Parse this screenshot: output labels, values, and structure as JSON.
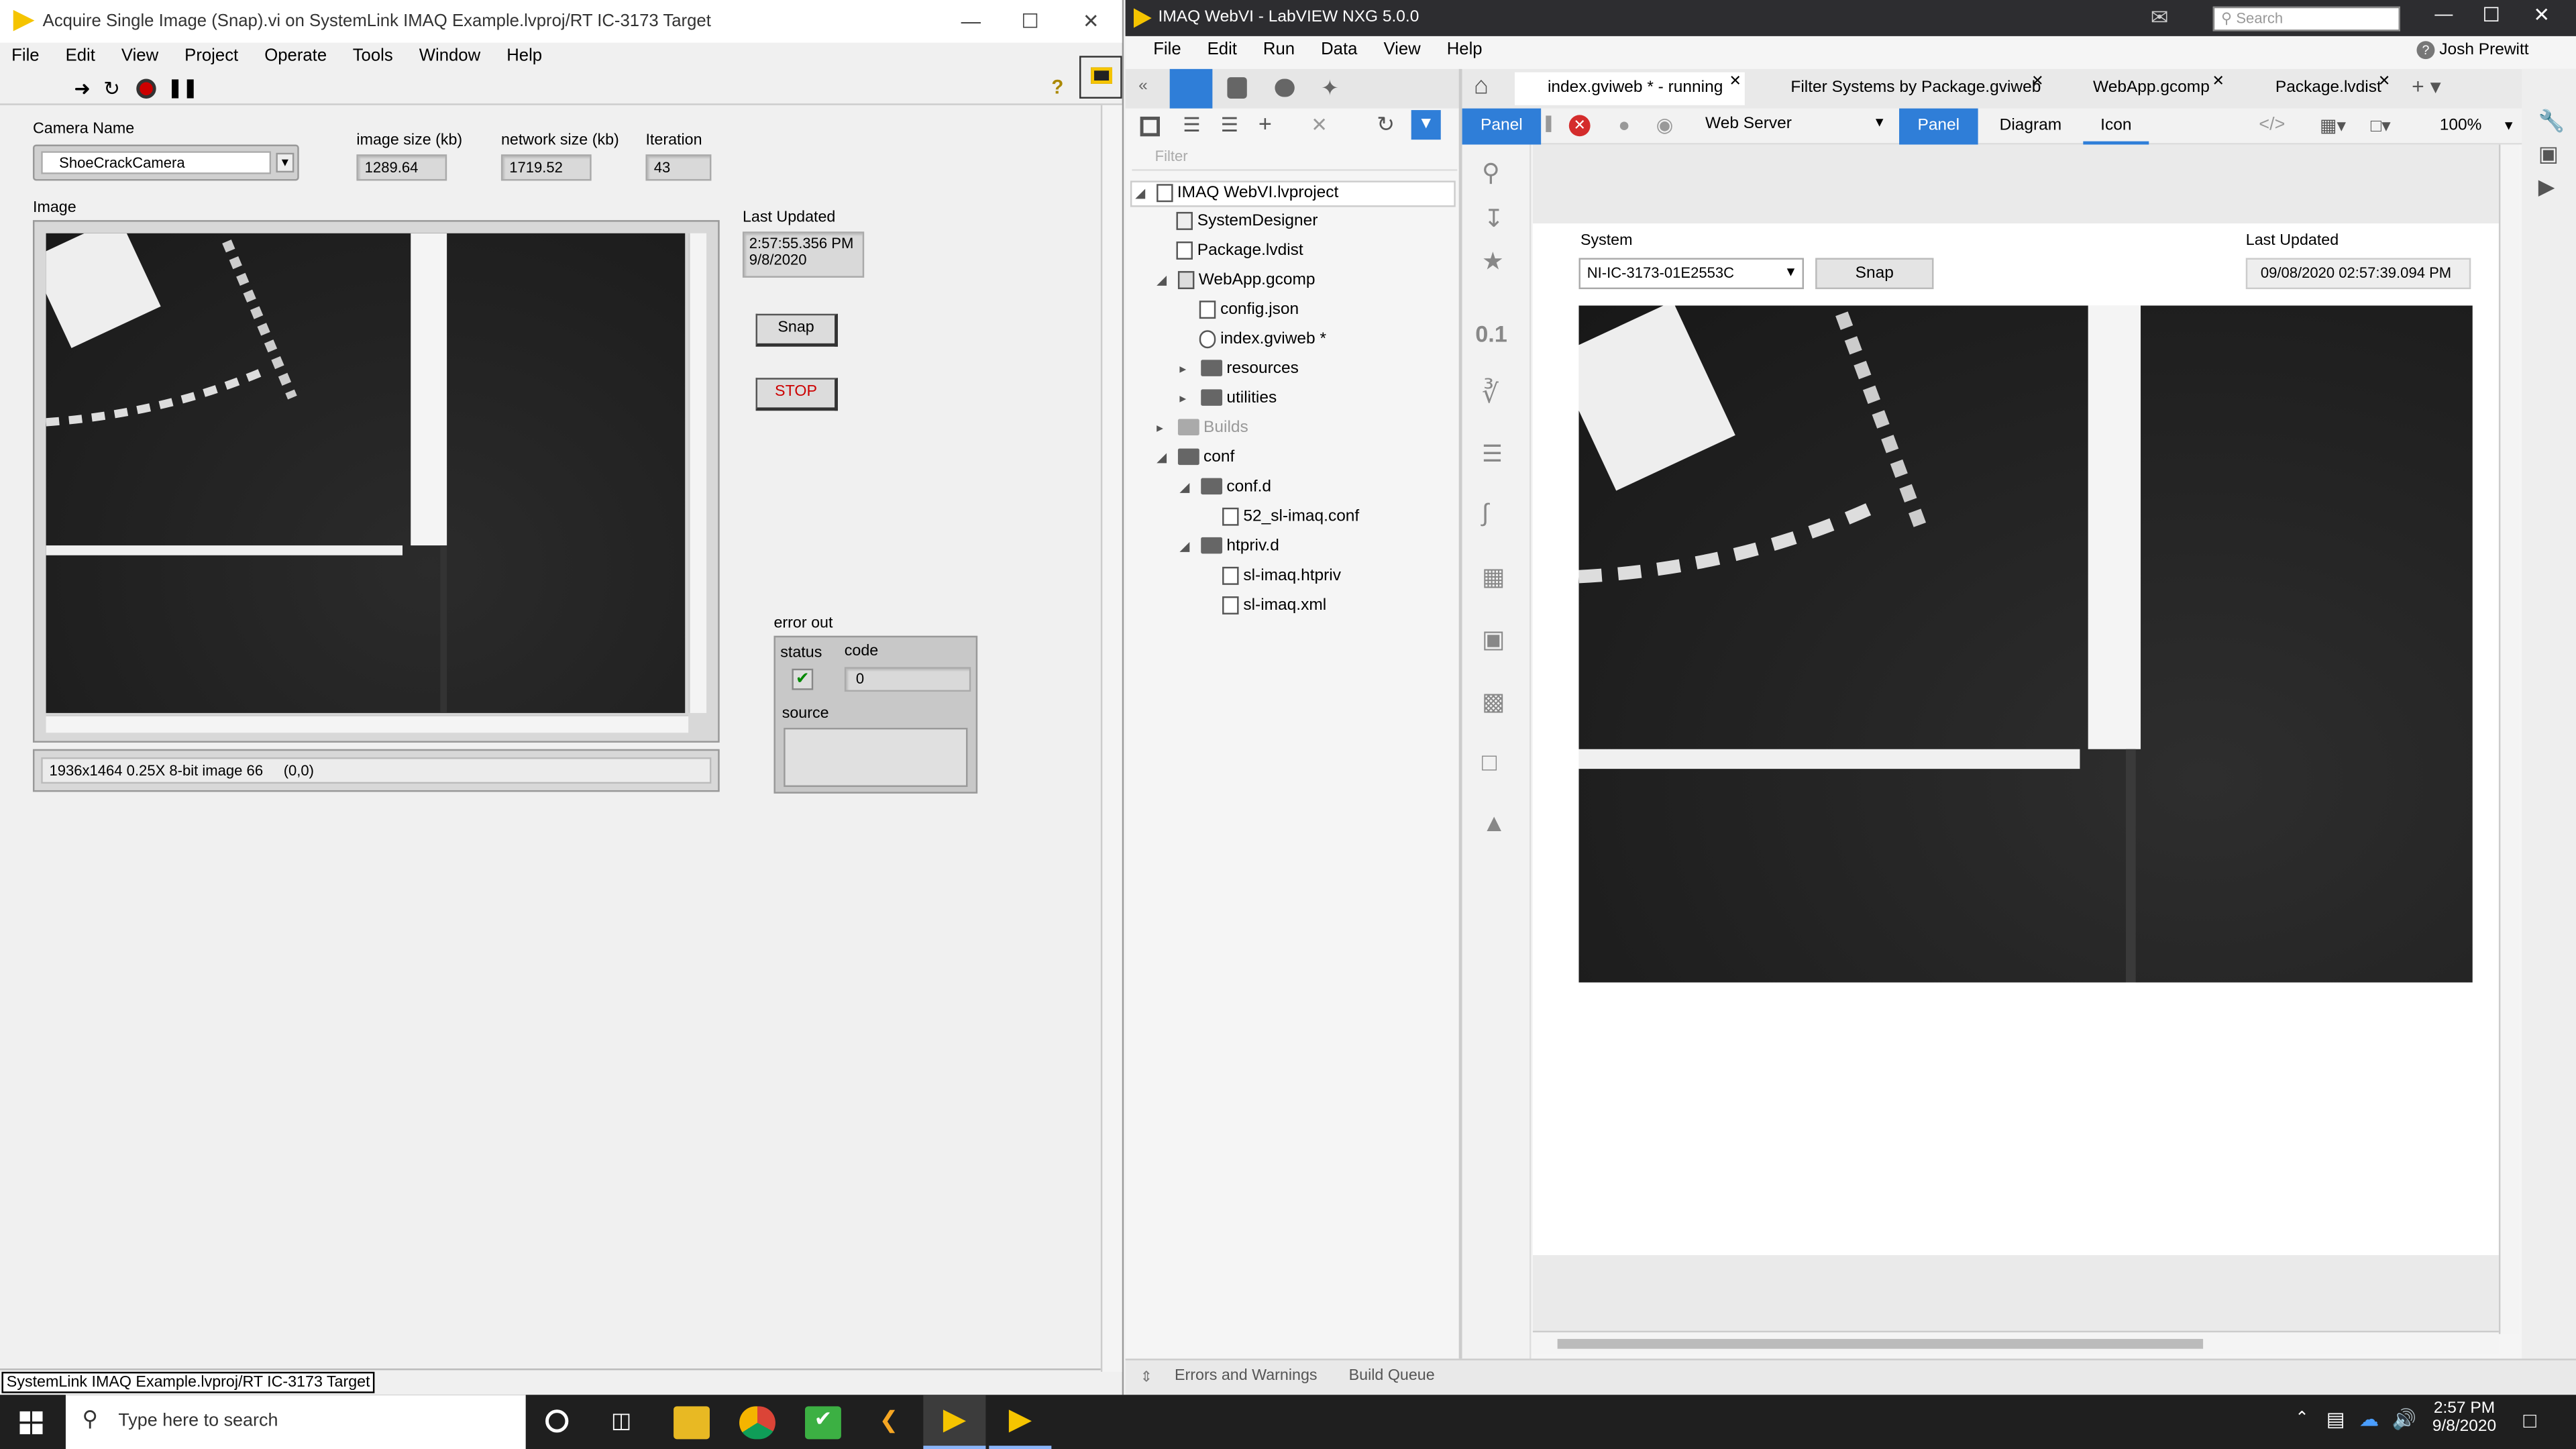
{
  "left_window": {
    "title": "Acquire Single Image (Snap).vi on SystemLink IMAQ Example.lvproj/RT IC-3173 Target",
    "menu": [
      "File",
      "Edit",
      "View",
      "Project",
      "Operate",
      "Tools",
      "Window",
      "Help"
    ],
    "camera_label": "Camera Name",
    "camera_value": "ShoeCrackCamera",
    "image_size_label": "image size (kb)",
    "image_size_value": "1289.64",
    "network_size_label": "network size (kb)",
    "network_size_value": "1719.52",
    "iteration_label": "Iteration",
    "iteration_value": "43",
    "image_label": "Image",
    "last_updated_label": "Last Updated",
    "last_updated_time": "2:57:55.356 PM",
    "last_updated_date": "9/8/2020",
    "snap_label": "Snap",
    "stop_label": "STOP",
    "image_info": "1936x1464 0.25X 8-bit image 66     (0,0)",
    "error_out_label": "error out",
    "status_label": "status",
    "code_label": "code",
    "code_value": "0",
    "source_label": "source",
    "status_bar": "SystemLink IMAQ Example.lvproj/RT IC-3173 Target"
  },
  "right_window": {
    "title": "IMAQ WebVI - LabVIEW NXG 5.0.0",
    "search_placeholder": "Search",
    "menu": [
      "File",
      "Edit",
      "Run",
      "Data",
      "View",
      "Help"
    ],
    "user": "Josh Prewitt",
    "tabs": [
      {
        "label": "index.gviweb * - running"
      },
      {
        "label": "Filter Systems by Package.gviweb"
      },
      {
        "label": "WebApp.gcomp"
      },
      {
        "label": "Package.lvdist"
      }
    ],
    "target": "Web Server",
    "view_tabs": [
      "Panel",
      "Diagram",
      "Icon"
    ],
    "zoom": "100%",
    "filter_placeholder": "Filter",
    "tree": [
      "IMAQ WebVI.lvproject",
      "SystemDesigner",
      "Package.lvdist",
      "WebApp.gcomp",
      "config.json",
      "index.gviweb *",
      "resources",
      "utilities",
      "Builds",
      "conf",
      "conf.d",
      "52_sl-imaq.conf",
      "htpriv.d",
      "sl-imaq.htpriv",
      "sl-imaq.xml"
    ],
    "system_label": "System",
    "system_value": "NI-IC-3173-01E2553C",
    "snap_label": "Snap",
    "last_updated_label": "Last Updated",
    "last_updated_value": "09/08/2020 02:57:39.094 PM",
    "bottom_tabs": [
      "Errors and Warnings",
      "Build Queue"
    ]
  },
  "taskbar": {
    "search_placeholder": "Type here to search",
    "time": "2:57 PM",
    "date": "9/8/2020"
  }
}
